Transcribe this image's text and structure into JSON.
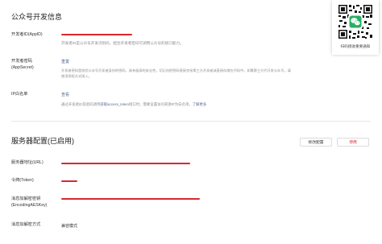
{
  "dev_info": {
    "title": "公众号开发信息",
    "appid": {
      "label": "开发者ID(AppID)",
      "desc": "开发者ID是公众号开发识别码，配合开发者密码可调用公众号的接口能力。"
    },
    "appsecret": {
      "label_line1": "开发者密码",
      "label_line2": "(AppSecret)",
      "action": "重置",
      "desc_line1": "开发者密码是校验公众号开发者身份的密码，具有极高的安全性。切记勿把密码直接交给第三方开发者或直接存储在代码中。如需第三方代开发公众号，请",
      "desc_line2": "使用授权方式接入。"
    },
    "ip_whitelist": {
      "label": "IP白名单",
      "action": "查看",
      "desc_prefix": "通过开发者ID及密码调用",
      "desc_link": "获取access_token",
      "desc_middle": "接口时，需要设置访问来源IP为白名单。",
      "desc_more": "了解更多"
    }
  },
  "server_config": {
    "title": "服务器配置(已启用)",
    "modify_button": "修改配置",
    "disable_button": "停用",
    "url_label": "服务器地址(URL)",
    "token_label": "令牌(Token)",
    "aeskey_label_line1": "消息加解密密钥",
    "aeskey_label_line2": "(EncodingAESKey)",
    "encrypt_mode_label": "消息加解密方式",
    "encrypt_mode_value": "兼容模式"
  },
  "qr_panel": {
    "caption": "扫码接收重要通知"
  },
  "colors": {
    "link": "#576b95",
    "redaction": "#d9272e",
    "divider": "#e7e7eb",
    "wechat_green": "#2aae67"
  }
}
